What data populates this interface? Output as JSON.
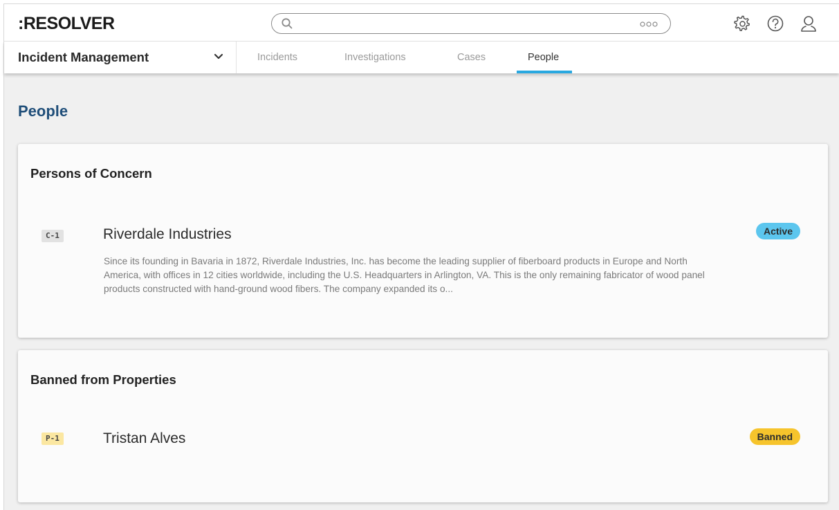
{
  "header": {
    "logo": ":RESOLVER",
    "search": {
      "placeholder": "",
      "value": ""
    },
    "icons": [
      "search-icon",
      "more-options-icon",
      "settings-gear-icon",
      "help-icon",
      "user-profile-icon"
    ]
  },
  "nav": {
    "app_name": "Incident Management",
    "tabs": [
      {
        "label": "Incidents",
        "active": false
      },
      {
        "label": "Investigations",
        "active": false
      },
      {
        "label": "Cases",
        "active": false
      },
      {
        "label": "People",
        "active": true
      }
    ],
    "accent_color": "#29a8e0"
  },
  "page": {
    "title": "People",
    "title_color": "#1f4e79"
  },
  "sections": [
    {
      "title": "Persons of Concern",
      "items": [
        {
          "id": "C-1",
          "name": "Riverdale Industries",
          "description": "Since its founding in Bavaria in 1872, Riverdale Industries, Inc. has become the leading supplier of fiberboard products in Europe and North America, with offices in 12 cities worldwide, including the U.S. Headquarters in Arlington, VA. This is the only remaining fabricator of wood panel products constructed with hand-ground wood fibers. The company expanded its o...",
          "status": "Active",
          "status_color": "#5cc6ee"
        }
      ]
    },
    {
      "title": "Banned from Properties",
      "items": [
        {
          "id": "P-1",
          "name": "Tristan Alves",
          "status": "Banned",
          "status_color": "#f6c42c"
        }
      ]
    }
  ]
}
